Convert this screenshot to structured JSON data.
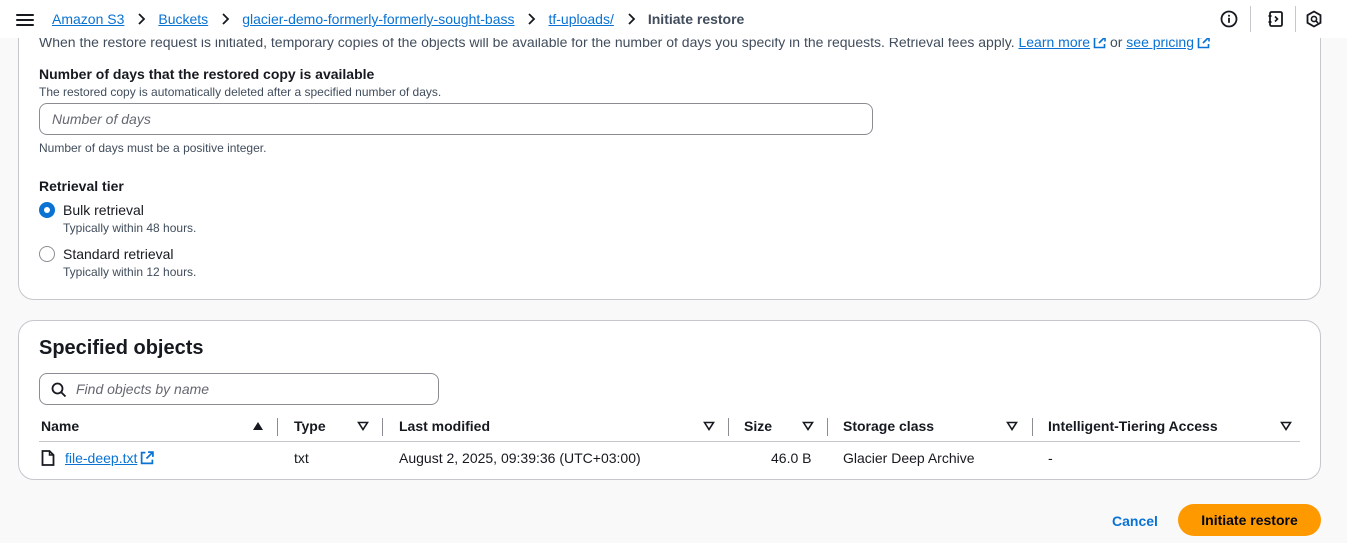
{
  "breadcrumbs": {
    "items": [
      "Amazon S3",
      "Buckets",
      "glacier-demo-formerly-formerly-sought-bass",
      "tf-uploads/"
    ],
    "current": "Initiate restore"
  },
  "restore": {
    "intro_text": "When the restore request is initiated, temporary copies of the objects will be available for the number of days you specify in the requests. Retrieval fees apply.",
    "learn_more": "Learn more",
    "or": "or",
    "see_pricing": "see pricing",
    "days_label": "Number of days that the restored copy is available",
    "days_description": "The restored copy is automatically deleted after a specified number of days.",
    "days_placeholder": "Number of days",
    "days_value": "",
    "days_constraint": "Number of days must be a positive integer.",
    "tier_label": "Retrieval tier",
    "tiers": [
      {
        "label": "Bulk retrieval",
        "description": "Typically within 48 hours.",
        "selected": true
      },
      {
        "label": "Standard retrieval",
        "description": "Typically within 12 hours.",
        "selected": false
      }
    ]
  },
  "objects": {
    "title": "Specified objects",
    "search_placeholder": "Find objects by name",
    "columns": [
      "Name",
      "Type",
      "Last modified",
      "Size",
      "Storage class",
      "Intelligent-Tiering Access"
    ],
    "rows": [
      {
        "name": "file-deep.txt",
        "type": "txt",
        "last_modified": "August 2, 2025, 09:39:36 (UTC+03:00)",
        "size": "46.0 B",
        "storage_class": "Glacier Deep Archive",
        "tiering_access": "-"
      }
    ]
  },
  "actions": {
    "cancel": "Cancel",
    "submit": "Initiate restore"
  },
  "colors": {
    "link": "#0972d3",
    "primary_button": "#ff9900",
    "radio_selected": "#0972d3"
  },
  "icons": [
    "menu-icon",
    "chevron-right-icon",
    "info-icon",
    "notes-icon",
    "cloudshell-icon",
    "external-link-icon",
    "search-icon",
    "file-icon",
    "sort-asc-icon",
    "sort-desc-icon"
  ]
}
